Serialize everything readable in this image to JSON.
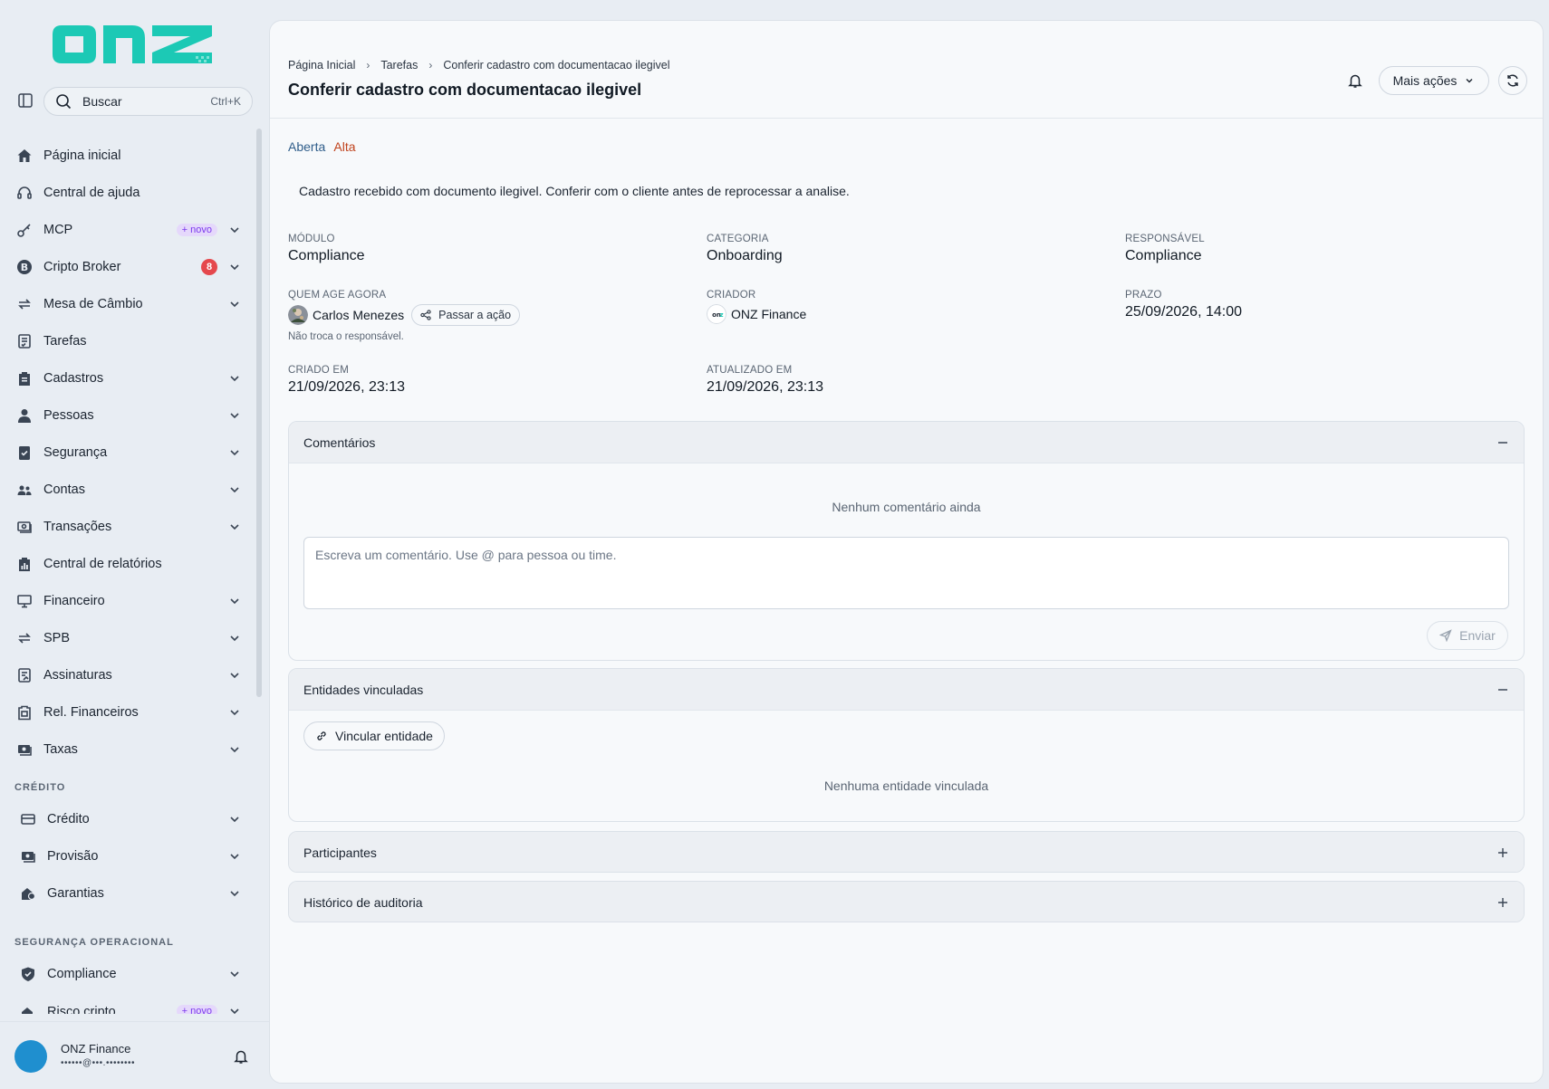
{
  "brand": {
    "logo_text": "onz",
    "color": "#1cc9b5"
  },
  "search": {
    "label": "Buscar",
    "shortcut": "Ctrl+K"
  },
  "sidebar": {
    "items": [
      {
        "label": "Página inicial",
        "icon": "home-icon",
        "chevron": false
      },
      {
        "label": "Central de ajuda",
        "icon": "headset-icon",
        "chevron": false
      },
      {
        "label": "MCP",
        "icon": "key-icon",
        "chevron": true,
        "badge_new": "+ novo"
      },
      {
        "label": "Cripto Broker",
        "icon": "bitcoin-icon",
        "chevron": true,
        "badge_count": "8"
      },
      {
        "label": "Mesa de Câmbio",
        "icon": "exchange-icon",
        "chevron": true
      },
      {
        "label": "Tarefas",
        "icon": "task-icon",
        "chevron": false
      },
      {
        "label": "Cadastros",
        "icon": "clipboard-icon",
        "chevron": true
      },
      {
        "label": "Pessoas",
        "icon": "person-icon",
        "chevron": true
      },
      {
        "label": "Segurança",
        "icon": "shield-check-icon",
        "chevron": true
      },
      {
        "label": "Contas",
        "icon": "users-icon",
        "chevron": true
      },
      {
        "label": "Transações",
        "icon": "money-icon",
        "chevron": true
      },
      {
        "label": "Central de relatórios",
        "icon": "report-icon",
        "chevron": false
      },
      {
        "label": "Financeiro",
        "icon": "finance-icon",
        "chevron": true
      },
      {
        "label": "SPB",
        "icon": "exchange-icon",
        "chevron": true
      },
      {
        "label": "Assinaturas",
        "icon": "signature-icon",
        "chevron": true
      },
      {
        "label": "Rel. Financeiros",
        "icon": "clipboard-report-icon",
        "chevron": true
      },
      {
        "label": "Taxas",
        "icon": "money-icon",
        "chevron": true
      }
    ],
    "section_credit": "CRÉDITO",
    "credit_items": [
      {
        "label": "Crédito",
        "icon": "card-icon",
        "chevron": true
      },
      {
        "label": "Provisão",
        "icon": "money-icon",
        "chevron": true
      },
      {
        "label": "Garantias",
        "icon": "guarantee-icon",
        "chevron": true
      }
    ],
    "section_ops": "SEGURANÇA OPERACIONAL",
    "ops_items": [
      {
        "label": "Compliance",
        "icon": "shield-icon",
        "chevron": true
      },
      {
        "label": "Risco cripto",
        "icon": "risk-icon",
        "chevron": true,
        "badge_new": "+ novo"
      }
    ]
  },
  "user": {
    "name": "ONZ Finance",
    "email": "••••••@•••.••••••••"
  },
  "header": {
    "breadcrumbs": [
      "Página Inicial",
      "Tarefas",
      "Conferir cadastro com documentacao ilegivel"
    ],
    "title": "Conferir cadastro com documentacao ilegivel",
    "more_actions": "Mais ações"
  },
  "task": {
    "status": "Aberta",
    "priority": "Alta",
    "description": "Cadastro recebido com documento ilegivel. Conferir com o cliente antes de reprocessar a analise.",
    "fields": {
      "modulo": {
        "label": "MÓDULO",
        "value": "Compliance"
      },
      "categoria": {
        "label": "CATEGORIA",
        "value": "Onboarding"
      },
      "responsavel": {
        "label": "RESPONSÁVEL",
        "value": "Compliance"
      },
      "quem_age": {
        "label": "QUEM AGE AGORA",
        "value": "Carlos Menezes",
        "action": "Passar a ação",
        "note": "Não troca o responsável."
      },
      "criador": {
        "label": "CRIADOR",
        "value": "ONZ Finance"
      },
      "prazo": {
        "label": "PRAZO",
        "value": "25/09/2026, 14:00"
      },
      "criado_em": {
        "label": "CRIADO EM",
        "value": "21/09/2026, 23:13"
      },
      "atualizado_em": {
        "label": "ATUALIZADO EM",
        "value": "21/09/2026, 23:13"
      }
    }
  },
  "panels": {
    "comments": {
      "title": "Comentários",
      "empty": "Nenhum comentário ainda",
      "placeholder": "Escreva um comentário. Use @ para pessoa ou time.",
      "send": "Enviar"
    },
    "entities": {
      "title": "Entidades vinculadas",
      "link_button": "Vincular entidade",
      "empty": "Nenhuma entidade vinculada"
    },
    "participants": {
      "title": "Participantes"
    },
    "audit": {
      "title": "Histórico de auditoria"
    }
  }
}
